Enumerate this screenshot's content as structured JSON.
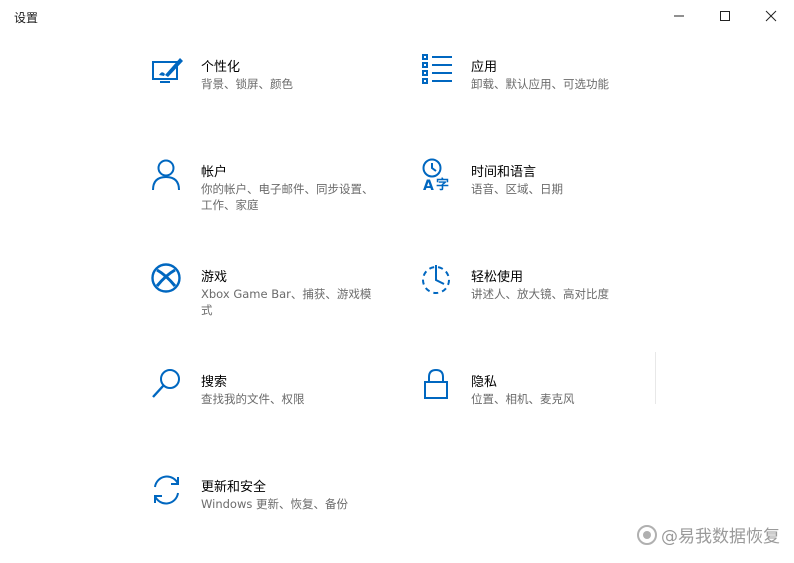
{
  "window": {
    "title": "设置"
  },
  "tiles": [
    {
      "id": "personalization",
      "name": "个性化",
      "desc": "背景、锁屏、颜色",
      "icon": "personalization-icon"
    },
    {
      "id": "apps",
      "name": "应用",
      "desc": "卸载、默认应用、可选功能",
      "icon": "apps-list-icon"
    },
    {
      "id": "accounts",
      "name": "帐户",
      "desc": "你的帐户、电子邮件、同步设置、工作、家庭",
      "icon": "person-icon"
    },
    {
      "id": "time-language",
      "name": "时间和语言",
      "desc": "语音、区域、日期",
      "icon": "time-language-icon"
    },
    {
      "id": "gaming",
      "name": "游戏",
      "desc": "Xbox Game Bar、捕获、游戏模式",
      "icon": "xbox-icon"
    },
    {
      "id": "ease-of-access",
      "name": "轻松使用",
      "desc": "讲述人、放大镜、高对比度",
      "icon": "ease-of-access-icon"
    },
    {
      "id": "search",
      "name": "搜索",
      "desc": "查找我的文件、权限",
      "icon": "search-icon"
    },
    {
      "id": "privacy",
      "name": "隐私",
      "desc": "位置、相机、麦克风",
      "icon": "lock-icon"
    },
    {
      "id": "update-security",
      "name": "更新和安全",
      "desc": "Windows 更新、恢复、备份",
      "icon": "sync-icon"
    }
  ],
  "watermark": {
    "text": "@易我数据恢复"
  },
  "colors": {
    "accent": "#0067c0",
    "text": "#000000",
    "secondary_text": "#6b6b6b",
    "background": "#ffffff"
  }
}
